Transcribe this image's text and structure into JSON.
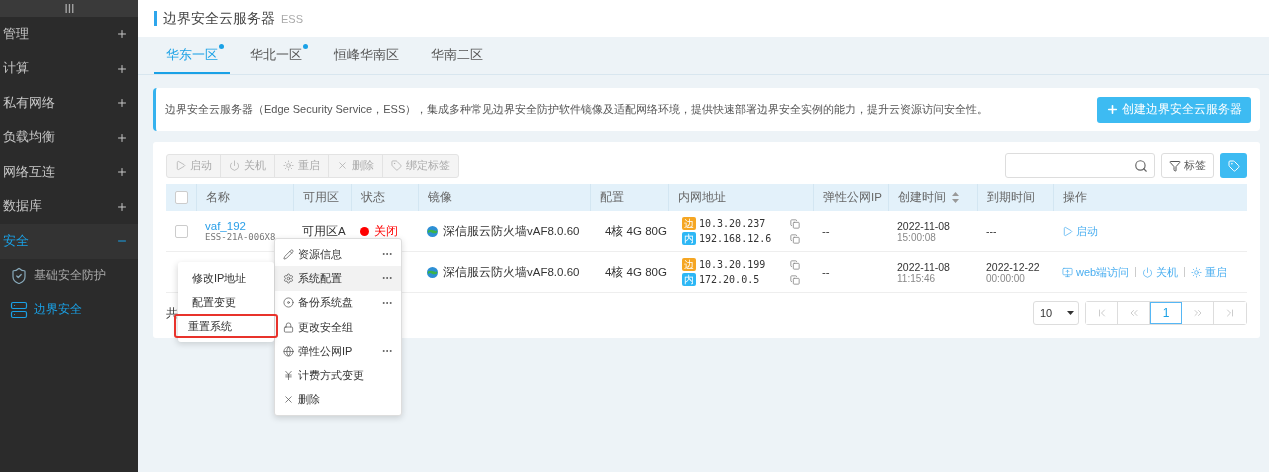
{
  "sidebar": {
    "items": [
      {
        "label": "管理",
        "expanded": false
      },
      {
        "label": "计算",
        "expanded": false
      },
      {
        "label": "私有网络",
        "expanded": false
      },
      {
        "label": "负载均衡",
        "expanded": false
      },
      {
        "label": "网络互连",
        "expanded": false
      },
      {
        "label": "数据库",
        "expanded": false
      },
      {
        "label": "安全",
        "expanded": true,
        "children": [
          {
            "label": "基础安全防护",
            "selected": false
          },
          {
            "label": "边界安全",
            "selected": true
          }
        ]
      }
    ]
  },
  "header": {
    "title": "边界安全云服务器",
    "subtitle": "ESS"
  },
  "tabs": [
    {
      "label": "华东一区",
      "selected": true,
      "dot": true
    },
    {
      "label": "华北一区",
      "selected": false,
      "dot": true
    },
    {
      "label": "恒峰华南区",
      "selected": false,
      "dot": false
    },
    {
      "label": "华南二区",
      "selected": false,
      "dot": false
    }
  ],
  "banner": {
    "text": "边界安全云服务器（Edge Security Service，ESS），集成多种常见边界安全防护软件镜像及适配网络环境，提供快速部署边界安全实例的能力，提升云资源访问安全性。",
    "button": "创建边界安全云服务器"
  },
  "toolbar": {
    "buttons": [
      {
        "label": "启动",
        "kind": "start",
        "disabled": true
      },
      {
        "label": "关机",
        "kind": "shutdown",
        "disabled": true
      },
      {
        "label": "重启",
        "kind": "restart",
        "disabled": true
      },
      {
        "label": "删除",
        "kind": "delete",
        "disabled": true
      },
      {
        "label": "绑定标签",
        "kind": "tag",
        "disabled": true
      }
    ],
    "tag_filter": "标签"
  },
  "table": {
    "all_checked": false,
    "columns": [
      {
        "label": "名称",
        "sortable": false
      },
      {
        "label": "可用区",
        "sortable": false
      },
      {
        "label": "状态",
        "sortable": false
      },
      {
        "label": "镜像",
        "sortable": false
      },
      {
        "label": "配置",
        "sortable": false
      },
      {
        "label": "内网地址",
        "sortable": false
      },
      {
        "label": "弹性公网IP",
        "sortable": false
      },
      {
        "label": "创建时间",
        "sortable": true
      },
      {
        "label": "到期时间",
        "sortable": false
      },
      {
        "label": "操作",
        "sortable": false
      }
    ],
    "rows": [
      {
        "checked": false,
        "name": "vaf_192",
        "id": "ESS-21A-006X8",
        "zone": "可用区A",
        "status": "关闭",
        "color": "#ff0000",
        "image": "深信服云防火墙vAF8.0.60",
        "config": "4核 4G 80G",
        "ips": [
          {
            "kind": "edge",
            "tag": "边",
            "address": "10.3.20.237"
          },
          {
            "kind": "internal",
            "tag": "内",
            "address": "192.168.12.6"
          }
        ],
        "eip": "--",
        "created_date": "2022-11-08",
        "created_time": "15:00:08",
        "expire_date": "---",
        "actions": [
          {
            "label": "启动",
            "kind": "start"
          }
        ]
      },
      {
        "image": "深信服云防火墙vAF8.0.60",
        "config": "4核 4G 80G",
        "ips": [
          {
            "kind": "edge",
            "tag": "边",
            "address": "10.3.20.199"
          },
          {
            "kind": "internal",
            "tag": "内",
            "address": "172.20.0.5"
          }
        ],
        "eip": "--",
        "created_date": "2022-11-08",
        "created_time": "11:15:46",
        "expire_date": "2022-12-22",
        "expire_time": "00:00:00",
        "actions": [
          {
            "label": "web端访问",
            "kind": "web"
          },
          {
            "label": "关机",
            "kind": "shutdown"
          },
          {
            "label": "重启",
            "kind": "restart"
          }
        ]
      }
    ]
  },
  "footer": {
    "total": "共",
    "page_size": "10",
    "pages": [
      {
        "label": "1",
        "selected": true
      }
    ]
  },
  "menu": {
    "items": [
      {
        "label": "资源信息",
        "kind": "info",
        "more": true,
        "selected": false
      },
      {
        "label": "系统配置",
        "kind": "config",
        "more": true,
        "selected": true
      },
      {
        "label": "备份系统盘",
        "kind": "backup",
        "more": true,
        "selected": false
      },
      {
        "label": "更改安全组",
        "kind": "security",
        "more": false,
        "selected": false
      },
      {
        "label": "弹性公网IP",
        "kind": "eip",
        "more": true,
        "selected": false
      },
      {
        "label": "计费方式变更",
        "kind": "billing",
        "more": false,
        "selected": false
      },
      {
        "label": "删除",
        "kind": "delete",
        "more": false,
        "selected": false
      }
    ]
  },
  "submenu": {
    "items": [
      {
        "label": "修改IP地址",
        "highlighted": false
      },
      {
        "label": "配置变更",
        "highlighted": false
      },
      {
        "label": "重置系统",
        "highlighted": true
      }
    ]
  }
}
